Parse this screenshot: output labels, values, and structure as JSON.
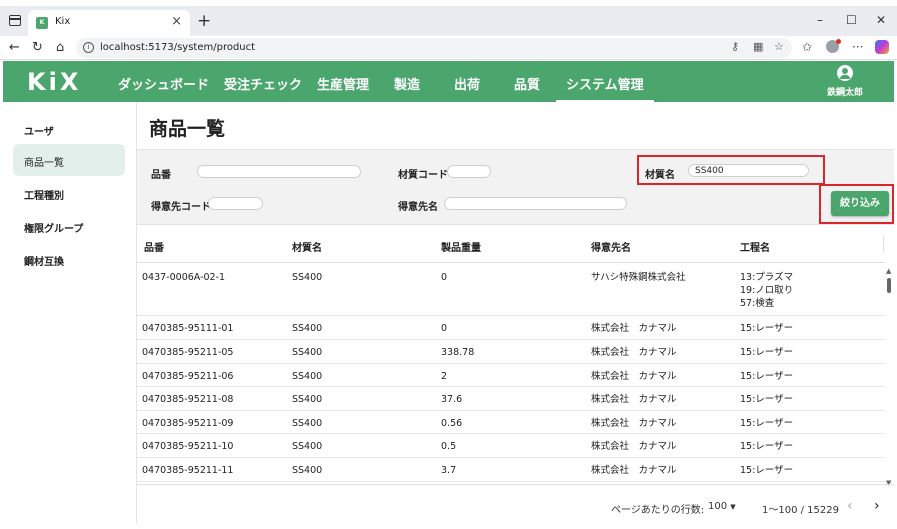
{
  "browser": {
    "tab_title": "Kix",
    "tab_close": "×",
    "new_tab": "+",
    "minimize": "–",
    "maximize": "☐",
    "close": "✕",
    "url": "localhost:5173/system/product"
  },
  "app": {
    "logo": "KiX",
    "nav": [
      {
        "label": "ダッシュボード"
      },
      {
        "label": "受注チェック"
      },
      {
        "label": "生産管理"
      },
      {
        "label": "製造"
      },
      {
        "label": "出荷"
      },
      {
        "label": "品質"
      },
      {
        "label": "システム管理"
      }
    ],
    "active_nav": "システム管理",
    "user_name": "鉄鋼太郎"
  },
  "sidebar": {
    "items": [
      {
        "label": "ユーザ"
      },
      {
        "label": "商品一覧"
      },
      {
        "label": "工程種別"
      },
      {
        "label": "権限グループ"
      },
      {
        "label": "鋼材互換"
      }
    ],
    "active_item": "商品一覧"
  },
  "page": {
    "title": "商品一覧"
  },
  "filters": {
    "product_code_label": "品番",
    "product_code_value": "",
    "material_code_label": "材質コード",
    "material_code_value": "",
    "material_name_label": "材質名",
    "material_name_value": "SS400",
    "customer_code_label": "得意先コード",
    "customer_code_value": "",
    "customer_name_label": "得意先名",
    "customer_name_value": "",
    "filter_button": "絞り込み"
  },
  "table": {
    "headers": [
      "品番",
      "材質名",
      "製品重量",
      "得意先名",
      "工程名"
    ],
    "rows": [
      {
        "code": "0437-0006A-02-1",
        "material": "SS400",
        "weight": "0",
        "customer": "サハシ特殊鋼株式会社",
        "process": "13:プラズマ\n19:ノロ取り\n57:検査"
      },
      {
        "code": "0470385-95111-01",
        "material": "SS400",
        "weight": "0",
        "customer": "株式会社　カナマル",
        "process": "15:レーザー"
      },
      {
        "code": "0470385-95211-05",
        "material": "SS400",
        "weight": "338.78",
        "customer": "株式会社　カナマル",
        "process": "15:レーザー"
      },
      {
        "code": "0470385-95211-06",
        "material": "SS400",
        "weight": "2",
        "customer": "株式会社　カナマル",
        "process": "15:レーザー"
      },
      {
        "code": "0470385-95211-08",
        "material": "SS400",
        "weight": "37.6",
        "customer": "株式会社　カナマル",
        "process": "15:レーザー"
      },
      {
        "code": "0470385-95211-09",
        "material": "SS400",
        "weight": "0.56",
        "customer": "株式会社　カナマル",
        "process": "15:レーザー"
      },
      {
        "code": "0470385-95211-10",
        "material": "SS400",
        "weight": "0.5",
        "customer": "株式会社　カナマル",
        "process": "15:レーザー"
      },
      {
        "code": "0470385-95211-11",
        "material": "SS400",
        "weight": "3.7",
        "customer": "株式会社　カナマル",
        "process": "15:レーザー"
      }
    ]
  },
  "pagination": {
    "rows_per_page_label": "ページあたりの行数:",
    "rows_per_page_value": "100",
    "range": "1〜100 / 15229",
    "prev": "‹",
    "next": "›"
  },
  "colors": {
    "brand_green": "#4aa66c",
    "highlight_red": "#d9252b"
  }
}
